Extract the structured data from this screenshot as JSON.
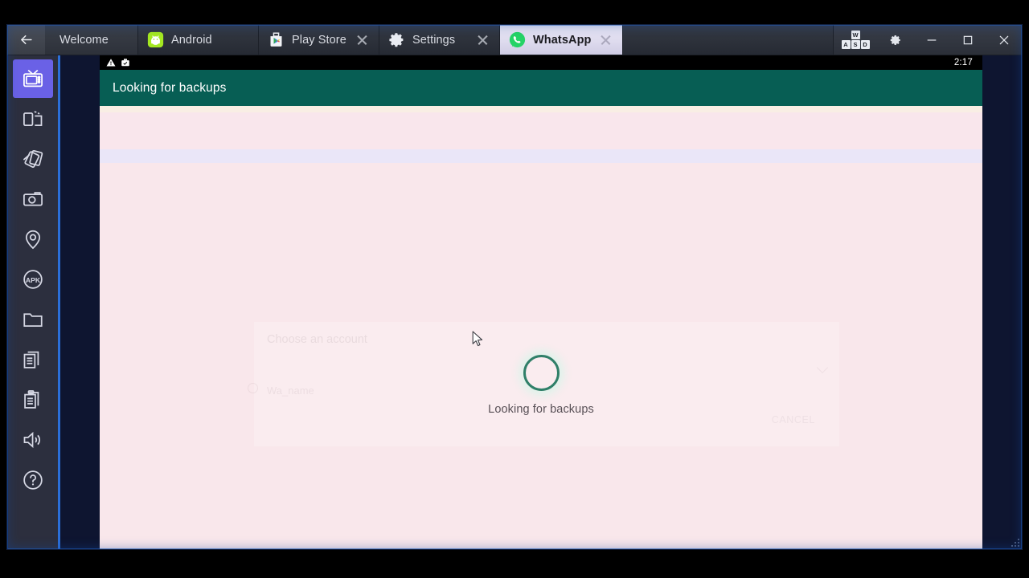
{
  "window": {
    "back_button": "back-arrow",
    "controls": {
      "keys_label": "WASD",
      "keys_row1": "W",
      "keys_row2_a": "A",
      "keys_row2_s": "S",
      "keys_row2_d": "D",
      "settings": "gear-icon",
      "minimize": "minimize",
      "maximize": "maximize",
      "close": "close"
    }
  },
  "tabs": [
    {
      "label": "Welcome",
      "icon": "none",
      "active": false,
      "closable": false
    },
    {
      "label": "Android",
      "icon": "android",
      "active": false,
      "closable": false
    },
    {
      "label": "Play Store",
      "icon": "play-store",
      "active": false,
      "closable": true
    },
    {
      "label": "Settings",
      "icon": "gear",
      "active": false,
      "closable": true
    },
    {
      "label": "WhatsApp",
      "icon": "whatsapp",
      "active": true,
      "closable": true
    }
  ],
  "sidebar": {
    "items": [
      {
        "name": "multi-instance-manager",
        "icon": "tv",
        "selected": true
      },
      {
        "name": "rotate-screen",
        "icon": "rotate",
        "selected": false
      },
      {
        "name": "shake",
        "icon": "cards",
        "selected": false
      },
      {
        "name": "screenshot",
        "icon": "camera",
        "selected": false
      },
      {
        "name": "location",
        "icon": "pin",
        "selected": false
      },
      {
        "name": "install-apk",
        "icon": "apk",
        "selected": false
      },
      {
        "name": "open-folder",
        "icon": "folder",
        "selected": false
      },
      {
        "name": "copy-to-android",
        "icon": "copy",
        "selected": false
      },
      {
        "name": "clipboard",
        "icon": "clipboard",
        "selected": false
      },
      {
        "name": "volume",
        "icon": "volume",
        "selected": false
      },
      {
        "name": "help",
        "icon": "help",
        "selected": false
      }
    ],
    "apk_label": "APK"
  },
  "android": {
    "statusbar": {
      "warning_icon": "warning-triangle",
      "work_icon": "work-briefcase",
      "time": "2:17"
    },
    "appbar": {
      "title": "Looking for backups"
    },
    "dialog": {
      "title": "Choose an account",
      "option": "Wa_name",
      "action": "CANCEL"
    },
    "progress": {
      "text": "Looking for backups",
      "spinner_color": "#2f7f68"
    }
  },
  "colors": {
    "whatsapp_green": "#075e54",
    "tab_active_bg": "#e2dff0",
    "rail_selected": "#6a61e6",
    "rail_accent": "#2b6fd8",
    "screen_bg": "#f9e7eb",
    "band_lavender": "#eae6f8"
  }
}
